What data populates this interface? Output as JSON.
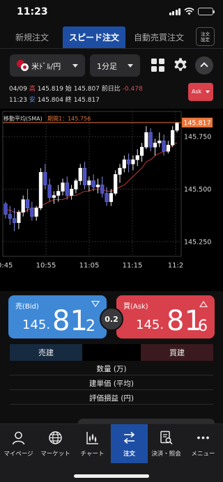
{
  "status": {
    "time": "11:23"
  },
  "tabs": [
    {
      "label": "新規注文",
      "active": false
    },
    {
      "label": "スピード注文",
      "active": true
    },
    {
      "label": "自動売買注文",
      "active": false
    }
  ],
  "order_settings": {
    "line1": "注文",
    "line2": "設定"
  },
  "toolbar": {
    "pair": "米ﾄﾞﾙ/円",
    "period": "1分足"
  },
  "ohlc": {
    "date": "04/09",
    "high_label": "高",
    "high": "145.819",
    "open_label": "始",
    "open": "145.807",
    "change_label": "前日比",
    "change": "-0.478",
    "time": "11:23",
    "low_label": "安",
    "low": "145.804",
    "close_label": "終",
    "close": "145.817"
  },
  "ask_select": {
    "label": "Ask"
  },
  "chart": {
    "sma_label": "移動平均(SMA)",
    "sma_period": "期間1：145.756",
    "current_price": "145.817",
    "x_ticks": [
      "10:45",
      "10:55",
      "11:05",
      "11:15",
      "11:2"
    ],
    "y_ticks": [
      "145.750",
      "145.500",
      "145.250"
    ]
  },
  "chart_data": {
    "type": "candlestick",
    "y_tick_values": [
      145.75,
      145.5,
      145.25
    ],
    "current_price": 145.817,
    "sma_period1": 145.756,
    "candles": [
      [
        145.43,
        145.44,
        145.36,
        145.38
      ],
      [
        145.38,
        145.42,
        145.33,
        145.36
      ],
      [
        145.36,
        145.41,
        145.3,
        145.34
      ],
      [
        145.34,
        145.4,
        145.31,
        145.39
      ],
      [
        145.39,
        145.47,
        145.37,
        145.45
      ],
      [
        145.45,
        145.5,
        145.39,
        145.41
      ],
      [
        145.41,
        145.44,
        145.35,
        145.37
      ],
      [
        145.37,
        145.42,
        145.35,
        145.41
      ],
      [
        145.41,
        145.6,
        145.4,
        145.58
      ],
      [
        145.58,
        145.62,
        145.5,
        145.52
      ],
      [
        145.52,
        145.55,
        145.44,
        145.46
      ],
      [
        145.46,
        145.49,
        145.43,
        145.47
      ],
      [
        145.47,
        145.52,
        145.44,
        145.49
      ],
      [
        145.49,
        145.55,
        145.47,
        145.53
      ],
      [
        145.53,
        145.56,
        145.45,
        145.47
      ],
      [
        145.47,
        145.52,
        145.45,
        145.5
      ],
      [
        145.5,
        145.55,
        145.48,
        145.54
      ],
      [
        145.54,
        145.62,
        145.52,
        145.6
      ],
      [
        145.6,
        145.63,
        145.5,
        145.52
      ],
      [
        145.52,
        145.56,
        145.49,
        145.54
      ],
      [
        145.54,
        145.57,
        145.49,
        145.51
      ],
      [
        145.51,
        145.55,
        145.48,
        145.52
      ],
      [
        145.52,
        145.56,
        145.46,
        145.48
      ],
      [
        145.48,
        145.51,
        145.42,
        145.44
      ],
      [
        145.44,
        145.5,
        145.42,
        145.48
      ],
      [
        145.48,
        145.59,
        145.47,
        145.57
      ],
      [
        145.57,
        145.62,
        145.53,
        145.6
      ],
      [
        145.6,
        145.66,
        145.58,
        145.64
      ],
      [
        145.64,
        145.67,
        145.58,
        145.62
      ],
      [
        145.62,
        145.66,
        145.59,
        145.64
      ],
      [
        145.64,
        145.69,
        145.61,
        145.66
      ],
      [
        145.66,
        145.72,
        145.63,
        145.7
      ],
      [
        145.7,
        145.8,
        145.69,
        145.77
      ],
      [
        145.77,
        145.79,
        145.68,
        145.7
      ],
      [
        145.7,
        145.74,
        145.66,
        145.72
      ],
      [
        145.72,
        145.77,
        145.7,
        145.73
      ],
      [
        145.73,
        145.76,
        145.66,
        145.68
      ],
      [
        145.68,
        145.73,
        145.67,
        145.71
      ],
      [
        145.71,
        145.8,
        145.7,
        145.78
      ],
      [
        145.78,
        145.82,
        145.77,
        145.817
      ]
    ],
    "sma": [
      145.4,
      145.4,
      145.39,
      145.39,
      145.39,
      145.4,
      145.41,
      145.41,
      145.42,
      145.43,
      145.44,
      145.45,
      145.45,
      145.45,
      145.46,
      145.47,
      145.47,
      145.48,
      145.49,
      145.49,
      145.5,
      145.5,
      145.5,
      145.49,
      145.49,
      145.5,
      145.51,
      145.52,
      145.54,
      145.56,
      145.58,
      145.6,
      145.63,
      145.64,
      145.66,
      145.67,
      145.68,
      145.69,
      145.71,
      145.72
    ],
    "x_tick_labels": [
      "10:45",
      "10:55",
      "11:05",
      "11:15",
      "11:2"
    ],
    "y_tick_labels": [
      "145.750",
      "145.500",
      "145.250"
    ]
  },
  "sell": {
    "label": "売(Bid)",
    "price_small": "145.",
    "price_big": "81",
    "price_last": "2"
  },
  "buy": {
    "label": "買(Ask)",
    "price_small": "145.",
    "price_big": "81",
    "price_last": "6"
  },
  "spread": "0.2",
  "positions": {
    "sell_header": "売建",
    "buy_header": "買建",
    "rows": [
      "数量 (万)",
      "建単価 (平均)",
      "評価損益 (円)"
    ]
  },
  "nav": [
    {
      "label": "マイページ",
      "icon": "person-icon",
      "active": false
    },
    {
      "label": "マーケット",
      "icon": "globe-icon",
      "active": false
    },
    {
      "label": "チャート",
      "icon": "chart-icon",
      "active": false
    },
    {
      "label": "注文",
      "icon": "swap-icon",
      "active": true
    },
    {
      "label": "決済・照会",
      "icon": "document-search-icon",
      "active": false
    },
    {
      "label": "メニュー",
      "icon": "more-icon",
      "active": false
    }
  ],
  "colors": {
    "accent": "#1d4ea3",
    "bid": "#3e88d6",
    "ask": "#d8404c",
    "up_candle": "#ffffff",
    "down_candle": "#4b4fc4",
    "sma_line": "#c0392b"
  }
}
